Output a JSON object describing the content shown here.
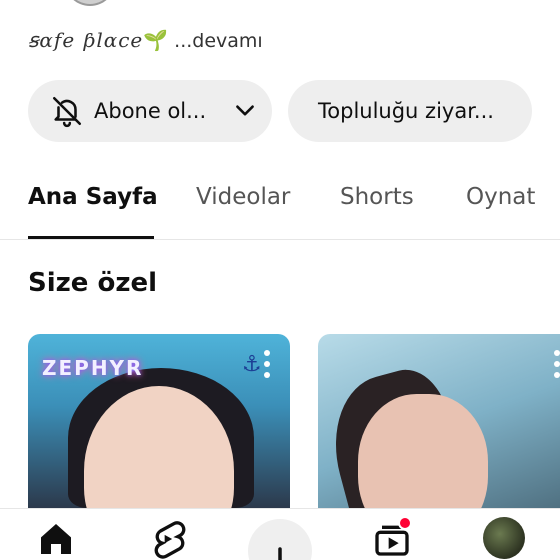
{
  "channel": {
    "description_text": "ꞩɑfe ƥlɑce",
    "description_emoji": "🌱",
    "description_more": "...devamı"
  },
  "actions": {
    "subscribe_label": "Abone ol...",
    "visit_community_label": "Topluluğu ziyar..."
  },
  "tabs": [
    {
      "label": "Ana Sayfa",
      "active": true
    },
    {
      "label": "Videolar",
      "active": false
    },
    {
      "label": "Shorts",
      "active": false
    },
    {
      "label": "Oynat",
      "active": false
    }
  ],
  "section": {
    "title": "Size özel"
  },
  "cards": [
    {
      "watermark": "ZEPHYR",
      "icon": "anchor-icon"
    },
    {
      "watermark": "",
      "icon": ""
    }
  ],
  "bottom_nav": [
    {
      "name": "home-icon",
      "active": true
    },
    {
      "name": "shorts-icon",
      "active": false
    },
    {
      "name": "create-icon",
      "active": false
    },
    {
      "name": "subscriptions-icon",
      "active": false,
      "notification": true
    },
    {
      "name": "profile-avatar",
      "active": false
    }
  ],
  "colors": {
    "accent": "#ff0033",
    "pill_bg": "#eeeeee",
    "text": "#0f0f0f"
  }
}
